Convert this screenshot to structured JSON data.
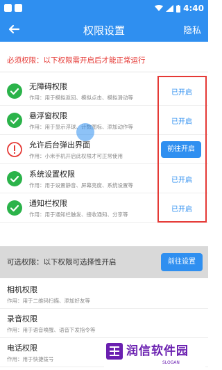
{
  "status_bar": {
    "time": "4:40"
  },
  "app_bar": {
    "title": "权限设置",
    "action": "隐私"
  },
  "required_section": {
    "header": "必须权限：以下权限需开启后才能正常运行",
    "items": [
      {
        "name": "无障碍权限",
        "desc": "作用：用于模拟返回、模拟点击、模拟滑动等",
        "status": "granted",
        "action_label": "已开启"
      },
      {
        "name": "悬浮窗权限",
        "desc": "作用：用于显示浮球、计数图标、添加动作等",
        "status": "granted",
        "action_label": "已开启"
      },
      {
        "name": "允许后台弹出界面",
        "desc": "作用：小米手机开启此权限才可正常使用",
        "status": "not_granted",
        "action_label": "前往开启"
      },
      {
        "name": "系统设置权限",
        "desc": "作用：用于设置静音、屏幕亮度、系统设置等",
        "status": "granted",
        "action_label": "已开启"
      },
      {
        "name": "通知栏权限",
        "desc": "作用：用于通知栏触发、接收通知、分享等",
        "status": "granted",
        "action_label": "已开启"
      }
    ]
  },
  "optional_section": {
    "header": "可选权限：以下权限可选择性开启",
    "button": "前往设置",
    "items": [
      {
        "name": "相机权限",
        "desc": "作用：用于二维码扫描、添加好友等"
      },
      {
        "name": "录音权限",
        "desc": "作用：用于语音唤醒、语音下发指令等"
      },
      {
        "name": "电话权限",
        "desc": "作用：用于快捷拨号"
      }
    ]
  },
  "watermark": {
    "text": "润信软件园",
    "slogan": "SLOGAN"
  },
  "colors": {
    "primary": "#2f8ff0",
    "granted": "#2bb34a",
    "warning": "#e53935"
  }
}
